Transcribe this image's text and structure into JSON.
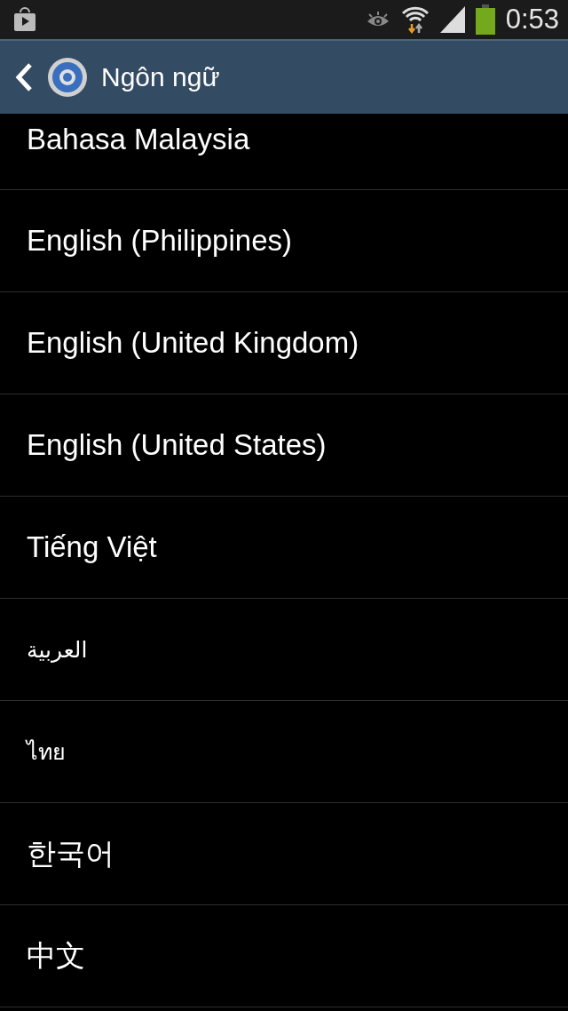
{
  "status_bar": {
    "time": "0:53"
  },
  "header": {
    "title": "Ngôn ngữ"
  },
  "languages": [
    {
      "label": "Bahasa Malaysia",
      "kind": "large"
    },
    {
      "label": "English (Philippines)",
      "kind": "large"
    },
    {
      "label": "English (United Kingdom)",
      "kind": "large"
    },
    {
      "label": "English (United States)",
      "kind": "large"
    },
    {
      "label": "Tiếng Việt",
      "kind": "large"
    },
    {
      "label": "العربية",
      "kind": "small"
    },
    {
      "label": "ไทย",
      "kind": "small"
    },
    {
      "label": "한국어",
      "kind": "large"
    },
    {
      "label": "中文",
      "kind": "large"
    }
  ]
}
